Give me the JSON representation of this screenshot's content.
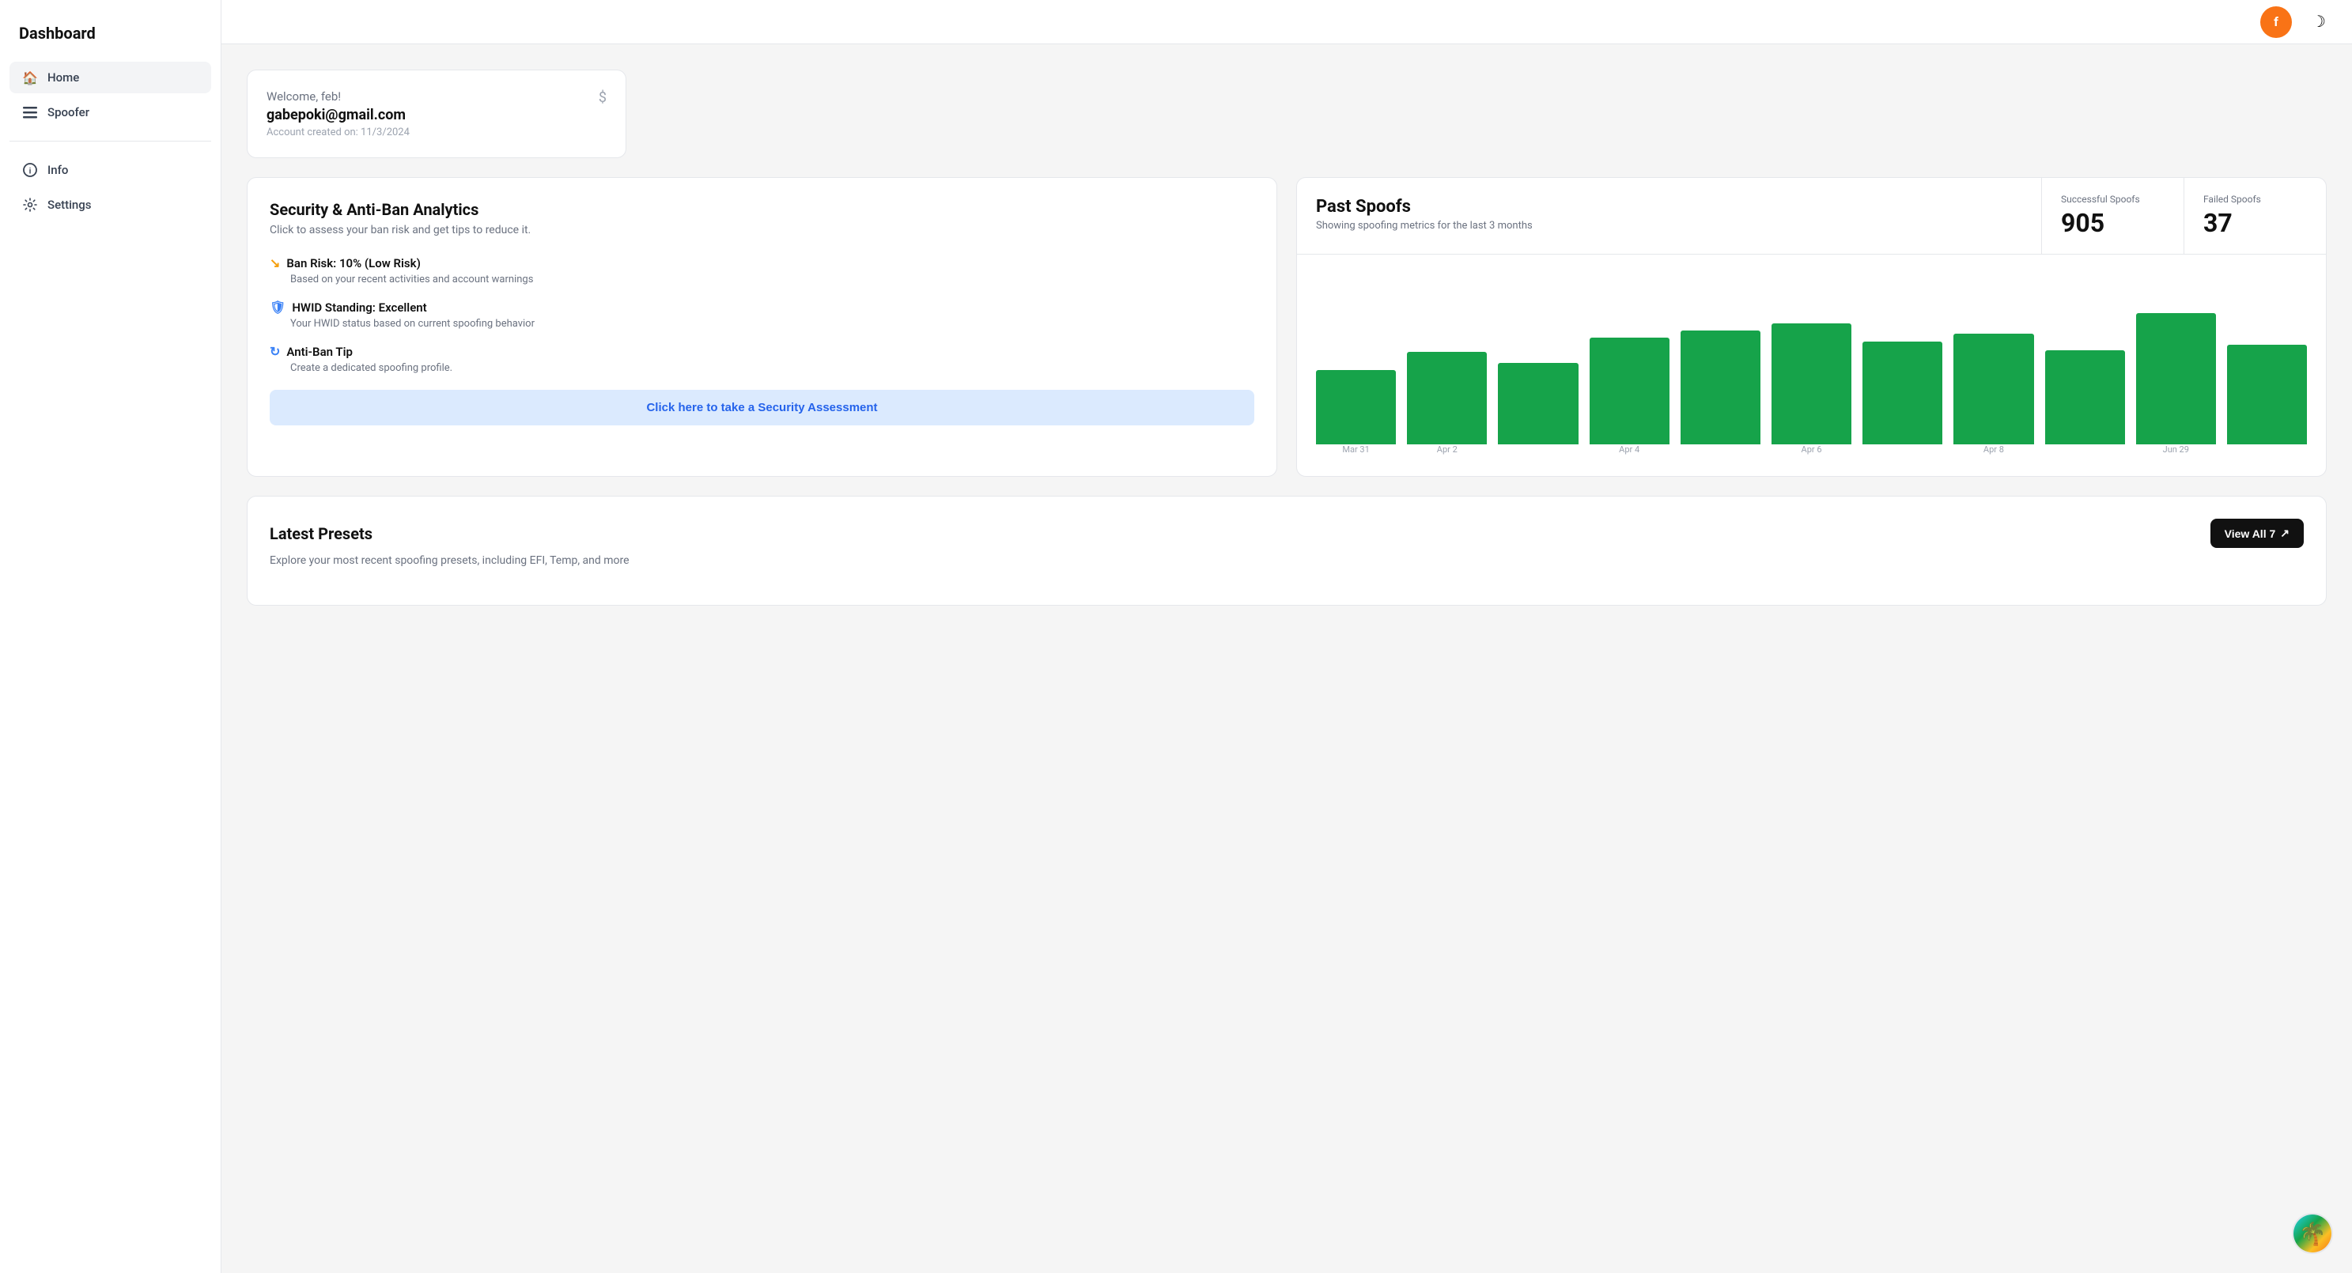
{
  "sidebar": {
    "title": "Dashboard",
    "items": [
      {
        "id": "home",
        "label": "Home",
        "icon": "🏠",
        "active": true
      },
      {
        "id": "spoofer",
        "label": "Spoofer",
        "icon": "☰",
        "active": false
      },
      {
        "id": "info",
        "label": "Info",
        "icon": "ⓘ",
        "active": false
      },
      {
        "id": "settings",
        "label": "Settings",
        "icon": "⚙",
        "active": false
      }
    ]
  },
  "header": {
    "avatar_letter": "f",
    "dark_mode_icon": "☽"
  },
  "welcome": {
    "greeting": "Welcome, feb!",
    "email": "gabepoki@gmail.com",
    "account_created": "Account created on: 11/3/2024"
  },
  "security": {
    "title": "Security & Anti-Ban Analytics",
    "subtitle": "Click to assess your ban risk and get tips to reduce it.",
    "ban_risk_label": "Ban Risk: 10% (Low Risk)",
    "ban_risk_desc": "Based on your recent activities and account warnings",
    "hwid_label": "HWID Standing: Excellent",
    "hwid_desc": "Your HWID status based on current spoofing behavior",
    "antiban_label": "Anti-Ban Tip",
    "antiban_desc": "Create a dedicated spoofing profile.",
    "assessment_btn": "Click here to take a Security Assessment"
  },
  "past_spoofs": {
    "title": "Past Spoofs",
    "subtitle": "Showing spoofing metrics for the last 3 months",
    "successful_label": "Successful Spoofs",
    "successful_value": "905",
    "failed_label": "Failed Spoofs",
    "failed_value": "37",
    "chart": {
      "bars": [
        {
          "label": "Mar 31",
          "height_pct": 52
        },
        {
          "label": "Apr 2",
          "height_pct": 65
        },
        {
          "label": "",
          "height_pct": 57
        },
        {
          "label": "Apr 4",
          "height_pct": 75
        },
        {
          "label": "",
          "height_pct": 80
        },
        {
          "label": "Apr 6",
          "height_pct": 85
        },
        {
          "label": "",
          "height_pct": 72
        },
        {
          "label": "Apr 8",
          "height_pct": 78
        },
        {
          "label": "",
          "height_pct": 66
        },
        {
          "label": "Jun 29",
          "height_pct": 92
        },
        {
          "label": "",
          "height_pct": 70
        }
      ]
    }
  },
  "presets": {
    "title": "Latest Presets",
    "subtitle": "Explore your most recent spoofing presets, including EFI, Temp, and more",
    "view_all_label": "View All ↗",
    "view_all_count": "View All 7"
  }
}
